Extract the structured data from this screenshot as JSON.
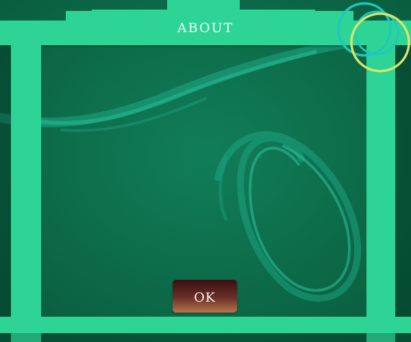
{
  "dialog": {
    "title": "ABOUT",
    "ok_label": "OK"
  },
  "decor": {
    "rings_icon": "concentric-rings-icon"
  },
  "colors": {
    "background": "#0e6b47",
    "frame": "#2ed496",
    "swirl": "#1fb08a",
    "ring_teal": "#1fc7c0",
    "ring_yellow": "#d8e56a",
    "button_top": "#3a0f12",
    "button_bottom": "#b8744b",
    "text": "#f4fff9"
  }
}
